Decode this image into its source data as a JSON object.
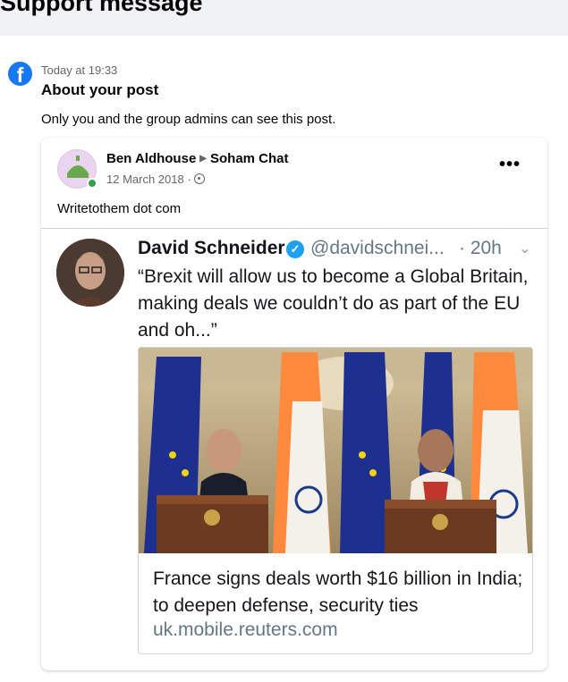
{
  "page": {
    "title": "Support message"
  },
  "message": {
    "time": "Today at 19:33",
    "heading": "About your post",
    "body": "Only you and the group admins can see this post."
  },
  "post": {
    "author": "Ben Aldhouse",
    "group": "Soham Chat",
    "date": "12 March 2018 ·",
    "more_label": "•••",
    "text": "Writetothem dot com"
  },
  "tweet": {
    "name": "David Schneider",
    "handle": "@davidschnei...",
    "time": "· 20h",
    "text": "“Brexit will allow us to become a Global Britain, making deals we couldn’t do as part of the EU and oh...”",
    "link": {
      "title": "France signs deals worth $16 billion in India; to deepen defense, security ties",
      "domain": "uk.mobile.reuters.com"
    }
  },
  "colors": {
    "facebook_blue": "#1877f2",
    "verified_blue": "#1da1f2",
    "online_green": "#31a24c"
  },
  "icons": {
    "facebook": "facebook-logo-icon",
    "verified": "verified-badge-icon",
    "privacy": "globe-icon",
    "caret": "chevron-down-icon"
  }
}
